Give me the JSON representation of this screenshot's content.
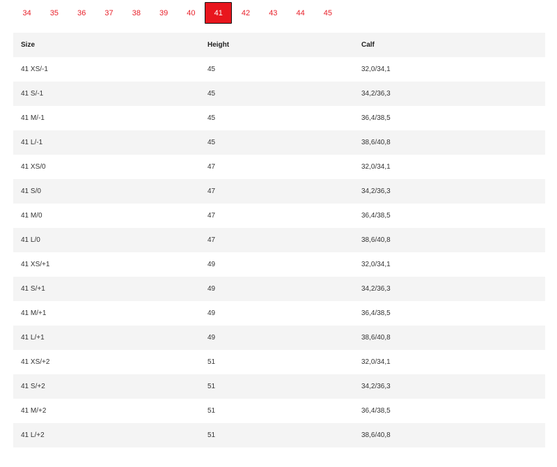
{
  "size_tabs": [
    {
      "label": "34",
      "active": false
    },
    {
      "label": "35",
      "active": false
    },
    {
      "label": "36",
      "active": false
    },
    {
      "label": "37",
      "active": false
    },
    {
      "label": "38",
      "active": false
    },
    {
      "label": "39",
      "active": false
    },
    {
      "label": "40",
      "active": false
    },
    {
      "label": "41",
      "active": true
    },
    {
      "label": "42",
      "active": false
    },
    {
      "label": "43",
      "active": false
    },
    {
      "label": "44",
      "active": false
    },
    {
      "label": "45",
      "active": false
    }
  ],
  "colors": {
    "tab_text": "#e8202a",
    "active_tab_bg": "#e8161e",
    "active_tab_text": "#ffffff",
    "stripe_bg": "#f4f4f4"
  },
  "table": {
    "headers": [
      "Size",
      "Height",
      "Calf"
    ],
    "rows": [
      [
        "41 XS/-1",
        "45",
        "32,0/34,1"
      ],
      [
        "41 S/-1",
        "45",
        "34,2/36,3"
      ],
      [
        "41 M/-1",
        "45",
        "36,4/38,5"
      ],
      [
        "41 L/-1",
        "45",
        "38,6/40,8"
      ],
      [
        "41 XS/0",
        "47",
        "32,0/34,1"
      ],
      [
        "41 S/0",
        "47",
        "34,2/36,3"
      ],
      [
        "41 M/0",
        "47",
        "36,4/38,5"
      ],
      [
        "41 L/0",
        "47",
        "38,6/40,8"
      ],
      [
        "41 XS/+1",
        "49",
        "32,0/34,1"
      ],
      [
        "41 S/+1",
        "49",
        "34,2/36,3"
      ],
      [
        "41 M/+1",
        "49",
        "36,4/38,5"
      ],
      [
        "41 L/+1",
        "49",
        "38,6/40,8"
      ],
      [
        "41 XS/+2",
        "51",
        "32,0/34,1"
      ],
      [
        "41 S/+2",
        "51",
        "34,2/36,3"
      ],
      [
        "41 M/+2",
        "51",
        "36,4/38,5"
      ],
      [
        "41 L/+2",
        "51",
        "38,6/40,8"
      ]
    ]
  }
}
